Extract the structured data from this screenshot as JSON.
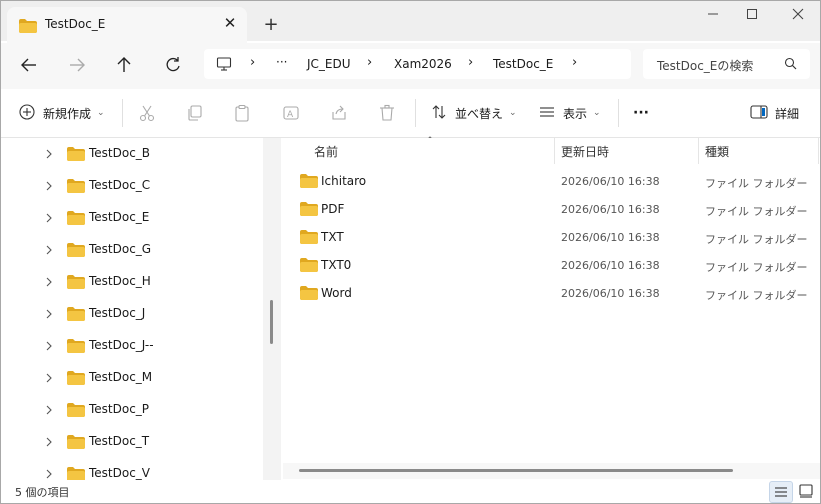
{
  "window": {
    "tab_title": "TestDoc_E",
    "new_tab_symbol": "+",
    "close_symbol": "✕"
  },
  "address": {
    "breadcrumbs": [
      "JC_EDU",
      "Xam2026",
      "TestDoc_E"
    ],
    "more": "···",
    "search_placeholder": "TestDoc_Eの検索"
  },
  "toolbar": {
    "new_label": "新規作成",
    "sort_label": "並べ替え",
    "view_label": "表示",
    "more_label": "···",
    "details_label": "詳細"
  },
  "nav_tree": {
    "items": [
      "TestDoc_B",
      "TestDoc_C",
      "TestDoc_E",
      "TestDoc_G",
      "TestDoc_H",
      "TestDoc_J",
      "TestDoc_J--",
      "TestDoc_M",
      "TestDoc_P",
      "TestDoc_T",
      "TestDoc_V"
    ]
  },
  "file_list": {
    "columns": {
      "name": "名前",
      "modified": "更新日時",
      "type": "種類"
    },
    "rows": [
      {
        "name": "Ichitaro",
        "modified": "2026/06/10 16:38",
        "type": "ファイル フォルダー"
      },
      {
        "name": "PDF",
        "modified": "2026/06/10 16:38",
        "type": "ファイル フォルダー"
      },
      {
        "name": "TXT",
        "modified": "2026/06/10 16:38",
        "type": "ファイル フォルダー"
      },
      {
        "name": "TXT0",
        "modified": "2026/06/10 16:38",
        "type": "ファイル フォルダー"
      },
      {
        "name": "Word",
        "modified": "2026/06/10 16:38",
        "type": "ファイル フォルダー"
      }
    ]
  },
  "status": {
    "item_count": "5 個の項目"
  },
  "colors": {
    "folder": "#f4c542",
    "folder_dark": "#e0a820",
    "accent": "#0067c0"
  }
}
